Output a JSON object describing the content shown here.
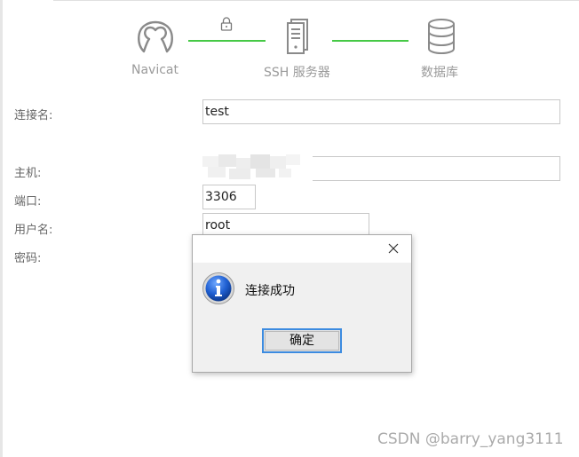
{
  "steps": {
    "navicat": "Navicat",
    "ssh": "SSH 服务器",
    "database": "数据库"
  },
  "icons": {
    "navicat": "navicat-logo-icon",
    "lock": "lock-icon",
    "server": "server-icon",
    "database": "database-icon",
    "info": "info-icon",
    "close": "close-icon"
  },
  "colors": {
    "connector": "#46c946",
    "icon_gray": "#8a8a8a",
    "button_focus": "#3c8be0"
  },
  "form": {
    "connection_name_label": "连接名:",
    "connection_name_value": "test",
    "host_label": "主机:",
    "port_label": "端口:",
    "port_value": "3306",
    "username_label": "用户名:",
    "username_value": "root",
    "password_label": "密码:"
  },
  "dialog": {
    "message": "连接成功",
    "ok_label": "确定"
  },
  "watermark": "CSDN @barry_yang3111"
}
